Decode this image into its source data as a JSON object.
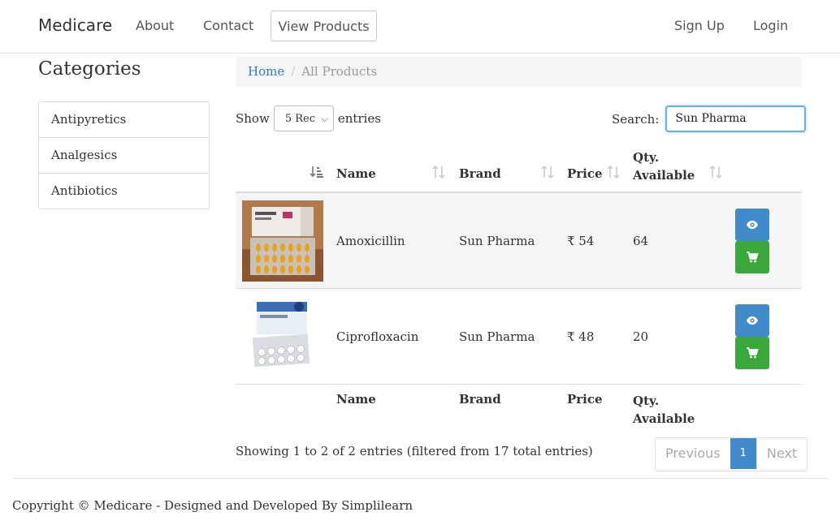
{
  "navbar": {
    "brand": "Medicare",
    "about": "About",
    "contact": "Contact",
    "view_products": "View Products",
    "sign_up": "Sign Up",
    "login": "Login"
  },
  "sidebar": {
    "title": "Categories",
    "items": [
      {
        "label": "Antipyretics"
      },
      {
        "label": "Analgesics"
      },
      {
        "label": "Antibiotics"
      }
    ]
  },
  "breadcrumb": {
    "home": "Home",
    "separator": "/",
    "current": "All Products"
  },
  "table_controls": {
    "show_label": "Show",
    "length_value": "5 Rec",
    "entries_label": "entries",
    "search_label": "Search:",
    "search_value": "Sun Pharma"
  },
  "table": {
    "columns": [
      "Name",
      "Brand",
      "Price",
      "Qty.",
      "Available"
    ],
    "rows": [
      {
        "name": "Amoxicillin",
        "brand": "Sun Pharma",
        "price": "₹ 54",
        "qty": "64",
        "image": "amoxicillin-box"
      },
      {
        "name": "Ciprofloxacin",
        "brand": "Sun Pharma",
        "price": "₹ 48",
        "qty": "20",
        "image": "ciprofloxacin-box"
      }
    ],
    "footer_columns": [
      "Name",
      "Brand",
      "Price",
      "Qty.",
      "Available"
    ]
  },
  "info": "Showing 1 to 2 of 2 entries (filtered from 17 total entries)",
  "pagination": {
    "previous": "Previous",
    "current": "1",
    "next": "Next"
  },
  "footer": {
    "text": "Copyright © Medicare - Designed and Developed By Simplilearn"
  },
  "colors": {
    "link": "#337ab7",
    "primary": "#428bca",
    "success": "#3aa83a"
  },
  "icons": [
    "sort-desc-icon",
    "sort-icon",
    "eye-icon",
    "cart-icon",
    "chevron-down-icon"
  ]
}
